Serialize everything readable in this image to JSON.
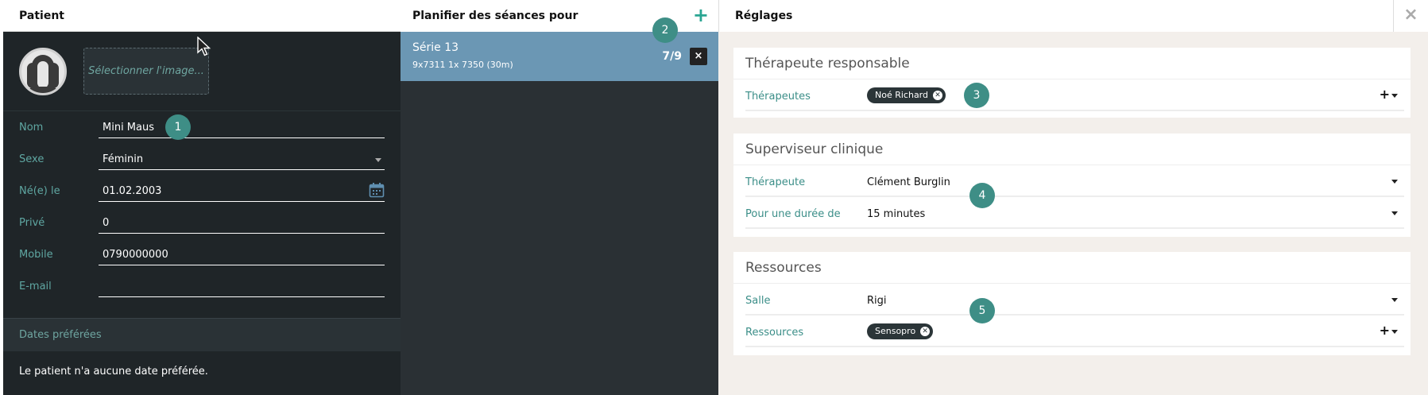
{
  "patient": {
    "title": "Patient",
    "select_image": "Sélectionner l'image...",
    "fields": [
      {
        "label": "Nom",
        "value": "Mini Maus"
      },
      {
        "label": "Sexe",
        "value": "Féminin"
      },
      {
        "label": "Né(e) le",
        "value": "01.02.2003"
      },
      {
        "label": "Privé",
        "value": "0"
      },
      {
        "label": "Mobile",
        "value": "0790000000"
      },
      {
        "label": "E-mail",
        "value": ""
      }
    ],
    "dates_title": "Dates préférées",
    "dates_text": "Le patient n'a aucune date préférée."
  },
  "planner": {
    "title": "Planifier des séances pour",
    "plus": "+",
    "serie": {
      "title": "Série 13",
      "subtitle": "9x7311 1x 7350 (30m)",
      "count": "7/9",
      "close": "×"
    }
  },
  "settings": {
    "title": "Réglages",
    "close": "×",
    "therapist_card": {
      "title": "Thérapeute responsable",
      "label": "Thérapeutes",
      "tag": "Noé Richard",
      "plus": "+"
    },
    "supervisor_card": {
      "title": "Superviseur clinique",
      "rows": [
        {
          "label": "Thérapeute",
          "value": "Clément Burglin"
        },
        {
          "label": "Pour une durée de",
          "value": "15 minutes"
        }
      ]
    },
    "resources_card": {
      "title": "Ressources",
      "room_label": "Salle",
      "room_value": "Rigi",
      "res_label": "Ressources",
      "res_tag": "Sensopro",
      "plus": "+"
    }
  },
  "markers": [
    "1",
    "2",
    "3",
    "4",
    "5"
  ],
  "colors": {
    "accent": "#3e8e86",
    "series_bg": "#6b97b4",
    "dark_panel": "#1f2528"
  }
}
